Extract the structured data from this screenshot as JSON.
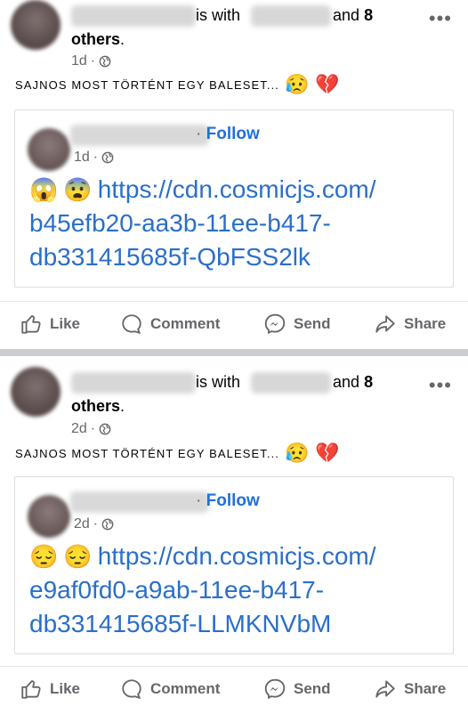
{
  "posts": [
    {
      "header": {
        "with_text": "is with",
        "and_text": "and",
        "count": "8",
        "others": "others",
        "period": "."
      },
      "time": "1d",
      "time_sep": "·",
      "message": "SAJNOS MOST TÖRTÉNT EGY BALESET...",
      "message_emojis": [
        "😥",
        "💔"
      ],
      "shared": {
        "sep": "·",
        "follow": "Follow",
        "time": "1d",
        "emojis": [
          "😱",
          "😨"
        ],
        "link_lines": [
          "https://cdn.cosmicjs.com/",
          "b45efb20-aa3b-11ee-b417-",
          "db331415685f-QbFSS2lk"
        ]
      }
    },
    {
      "header": {
        "with_text": "is with",
        "and_text": "and",
        "count": "8",
        "others": "others",
        "period": "."
      },
      "time": "2d",
      "time_sep": "·",
      "message": "SAJNOS MOST TÖRTÉNT EGY BALESET...",
      "message_emojis": [
        "😥",
        "💔"
      ],
      "shared": {
        "sep": "·",
        "follow": "Follow",
        "time": "2d",
        "emojis": [
          "😔",
          "😔"
        ],
        "link_lines": [
          "https://cdn.cosmicjs.com/",
          "e9af0fd0-a9ab-11ee-b417-",
          "db331415685f-LLMKNVbM"
        ]
      }
    }
  ],
  "actions": {
    "like": "Like",
    "comment": "Comment",
    "send": "Send",
    "share": "Share"
  },
  "more_glyph": "•••",
  "colors": {
    "link": "#2a6fc9",
    "follow": "#216fdb",
    "muted": "#65676b"
  }
}
